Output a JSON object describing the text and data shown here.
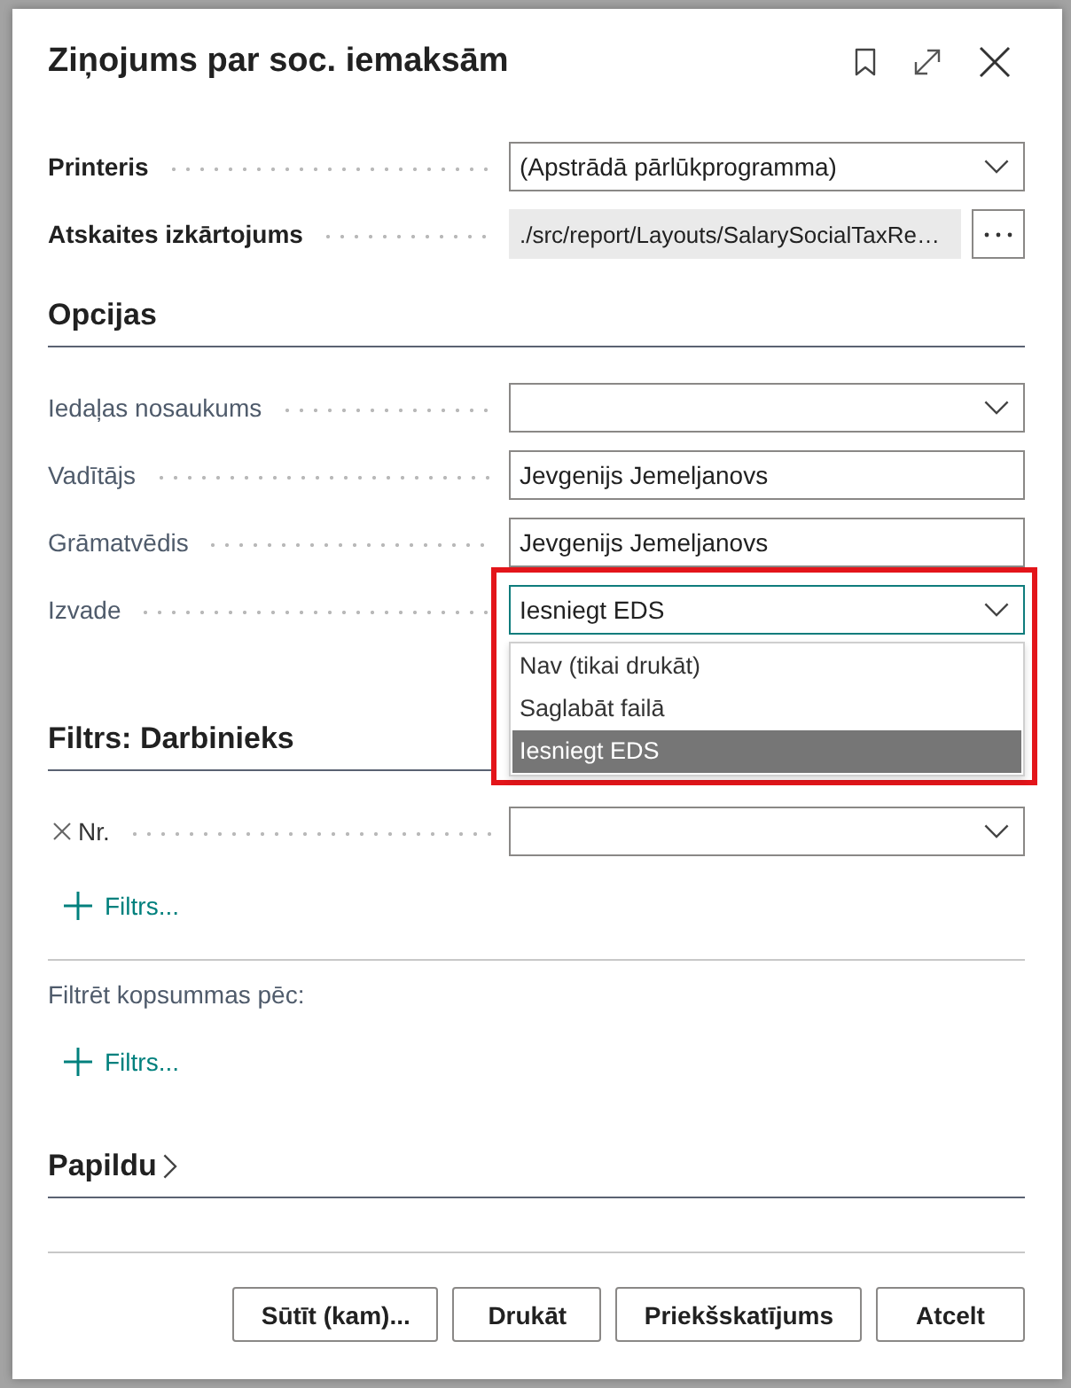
{
  "dialog": {
    "title": "Ziņojums par soc. iemaksām"
  },
  "general": {
    "fields": [
      {
        "label": "Printeris",
        "kind": "dropdown",
        "value": "(Apstrādā pārlūkprogramma)",
        "emphasized": true,
        "expanded": false,
        "highlighted": false
      },
      {
        "label": "Atskaites izkārtojums",
        "kind": "readonly",
        "value": "./src/report/Layouts/SalarySocialTaxRe…",
        "emphasized": true,
        "highlighted": false
      }
    ]
  },
  "options": {
    "title": "Opcijas",
    "fields": [
      {
        "label": "Iedaļas nosaukums",
        "kind": "dropdown",
        "emphasized": false,
        "expanded": false,
        "highlighted": false
      },
      {
        "label": "Vadītājs",
        "kind": "text",
        "value": "Jevgenijs Jemeljanovs",
        "emphasized": false,
        "highlighted": false
      },
      {
        "label": "Grāmatvēdis",
        "kind": "text",
        "value": "Jevgenijs Jemeljanovs",
        "emphasized": false,
        "highlighted": false
      },
      {
        "label": "Izvade",
        "kind": "dropdown",
        "value": "Iesniegt EDS",
        "emphasized": false,
        "expanded": true,
        "highlighted": true,
        "choices": [
          {
            "label": "Nav (tikai drukāt)",
            "selected": false
          },
          {
            "label": "Saglabāt failā",
            "selected": false
          },
          {
            "label": "Iesniegt EDS",
            "selected": true
          }
        ]
      }
    ]
  },
  "employee_filter": {
    "title": "Filtrs: Darbinieks",
    "filters": [
      {
        "label": "Nr.",
        "expanded": false
      }
    ],
    "add_filter": "Filtrs..."
  },
  "totals_filter": {
    "label": "Filtrēt kopsummas pēc:",
    "add_filter": "Filtrs..."
  },
  "advanced": {
    "title": "Papildu",
    "expanded": false
  },
  "buttons": [
    {
      "label": "Sūtīt (kam)..."
    },
    {
      "label": "Drukāt"
    },
    {
      "label": "Priekšskatījums"
    },
    {
      "label": "Atcelt"
    }
  ]
}
